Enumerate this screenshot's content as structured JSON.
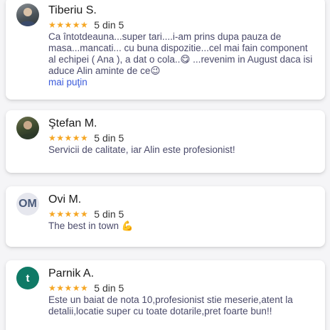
{
  "reviews": [
    {
      "name": "Tiberiu S.",
      "avatar": "user-photo",
      "stars": "★★★★★",
      "score": "5 din 5",
      "text": "Ca întotdeauna...super tari....i-am prins dupa pauza de masa...mancati... cu buna dispozitie...cel mai fain component al echipei ( Ana ), a dat o cola..😋 ...revenim in August daca isi aduce Alin aminte de ce😉",
      "more": "mai puţin"
    },
    {
      "name": "Ştefan M.",
      "avatar": "user-photo",
      "stars": "★★★★★",
      "score": "5 din 5",
      "text": "Servicii de calitate, iar Alin este profesionist!"
    },
    {
      "name": "Ovi M.",
      "avatar_initials": "OM",
      "stars": "★★★★★",
      "score": "5 din 5",
      "text": "The best in town 💪"
    },
    {
      "name": "Parnik A.",
      "avatar_initials": "t",
      "stars": "★★★★★",
      "score": "5 din 5",
      "text": "Este un baiat de nota 10,profesionist stie meserie,atent la detalii,locatie super cu toate dotarile,pret foarte bun!!"
    }
  ],
  "colors": {
    "star": "#f5a623",
    "link": "#3b5bdb",
    "text": "#4a4a6a",
    "avatar_teal": "#0f7a66",
    "avatar_grey": "#e6e7ee"
  }
}
